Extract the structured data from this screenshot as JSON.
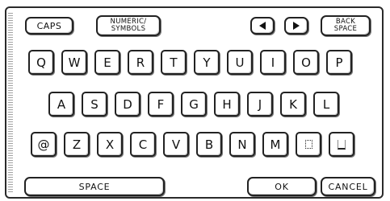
{
  "top_bar": {
    "caps_label": "CAPS",
    "numeric_line1": "NUMERIC/",
    "numeric_line2": "SYMBOLS",
    "backspace_line1": "BACK",
    "backspace_line2": "SPACE"
  },
  "keyboard": {
    "row1": [
      "Q",
      "W",
      "E",
      "R",
      "T",
      "Y",
      "U",
      "I",
      "O",
      "P"
    ],
    "row2": [
      "A",
      "S",
      "D",
      "F",
      "G",
      "H",
      "J",
      "K",
      "L"
    ],
    "row3": [
      "@",
      "Z",
      "X",
      "C",
      "V",
      "B",
      "N",
      "M"
    ]
  },
  "bottom_bar": {
    "space_label": "SPACE",
    "ok_label": "OK",
    "cancel_label": "CANCEL"
  },
  "icons": {
    "left_arrow": "left-arrow-icon",
    "right_arrow": "right-arrow-icon",
    "dot_key": "dot-symbol-icon",
    "underscore_key": "underscore-symbol-icon"
  }
}
